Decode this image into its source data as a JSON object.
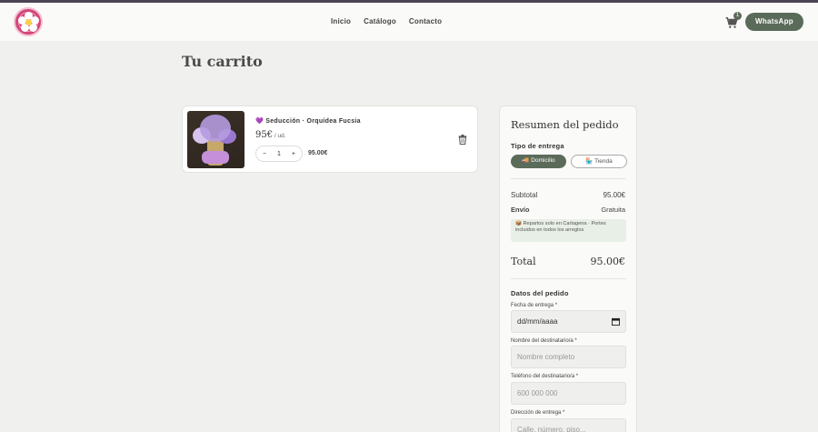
{
  "header": {
    "logo_name": "flower-logo",
    "nav": [
      "Inicio",
      "Catálogo",
      "Contacto"
    ],
    "cart_count": "1",
    "whatsapp_label": "WhatsApp"
  },
  "page": {
    "title": "Tu carrito"
  },
  "cart": {
    "item": {
      "name": "💜 Seducción · Orquídea Fucsia",
      "price": "95€",
      "unit": " / ud.",
      "qty_minus": "−",
      "qty": "1",
      "qty_plus": "+",
      "line_total": "95.00€"
    }
  },
  "summary": {
    "title": "Resumen del pedido",
    "delivery_label": "Tipo de entrega",
    "delivery_options": [
      "🚚 Domicilio",
      "🏪 Tienda"
    ],
    "subtotal_label": "Subtotal",
    "subtotal_value": "95.00€",
    "shipping_label": "Envío",
    "shipping_value": "Gratuita",
    "note": "📦 Repartos solo en Cartagena · Portes incluidos en todos los arreglos",
    "total_label": "Total",
    "total_value": "95.00€",
    "order_data_label": "Datos del pedido",
    "fields": [
      {
        "label": "Fecha de entrega *",
        "value": "dd/mm/aaaa"
      },
      {
        "label": "Nombre del destinatario/a *",
        "placeholder": "Nombre completo"
      },
      {
        "label": "Teléfono del destinatario/a *",
        "placeholder": "600 000 000"
      },
      {
        "label": "Dirección de entrega *",
        "placeholder": "Calle, número, piso..."
      }
    ]
  },
  "colors": {
    "accent": "#5b6b5a",
    "background": "#f0f0ee",
    "logo": "#d2467a"
  }
}
